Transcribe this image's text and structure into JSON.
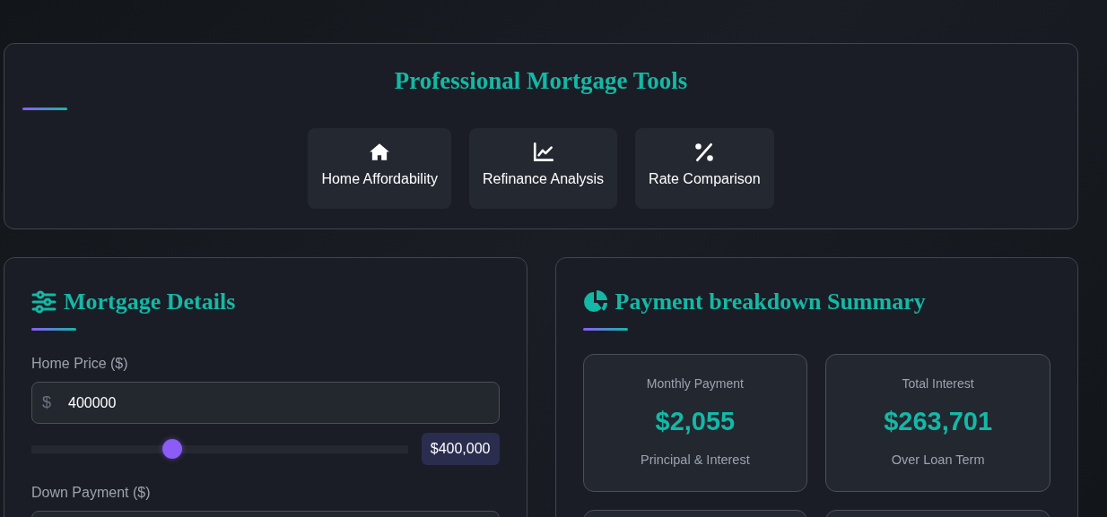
{
  "tools": {
    "title": "Professional Mortgage Tools",
    "items": [
      {
        "label": "Home Affordability",
        "kind": "home"
      },
      {
        "label": "Refinance Analysis",
        "kind": "chart"
      },
      {
        "label": "Rate Comparison",
        "kind": "percent"
      }
    ]
  },
  "details": {
    "title": "Mortgage Details",
    "fields": [
      {
        "label": "Home Price ($)",
        "prefix": "$",
        "value": "400000",
        "level": 0.375,
        "reading": "$400,000"
      },
      {
        "label": "Down Payment ($)"
      }
    ]
  },
  "summary": {
    "title": "Payment breakdown Summary",
    "cards": [
      {
        "kind": "stat",
        "label": "Monthly Payment",
        "value": "$2,055",
        "note": "Principal & Interest"
      },
      {
        "kind": "stat",
        "label": "Total Interest",
        "value": "$263,701",
        "note": "Over Loan Term"
      },
      {
        "kind": "cut"
      },
      {
        "kind": "cut"
      }
    ]
  }
}
